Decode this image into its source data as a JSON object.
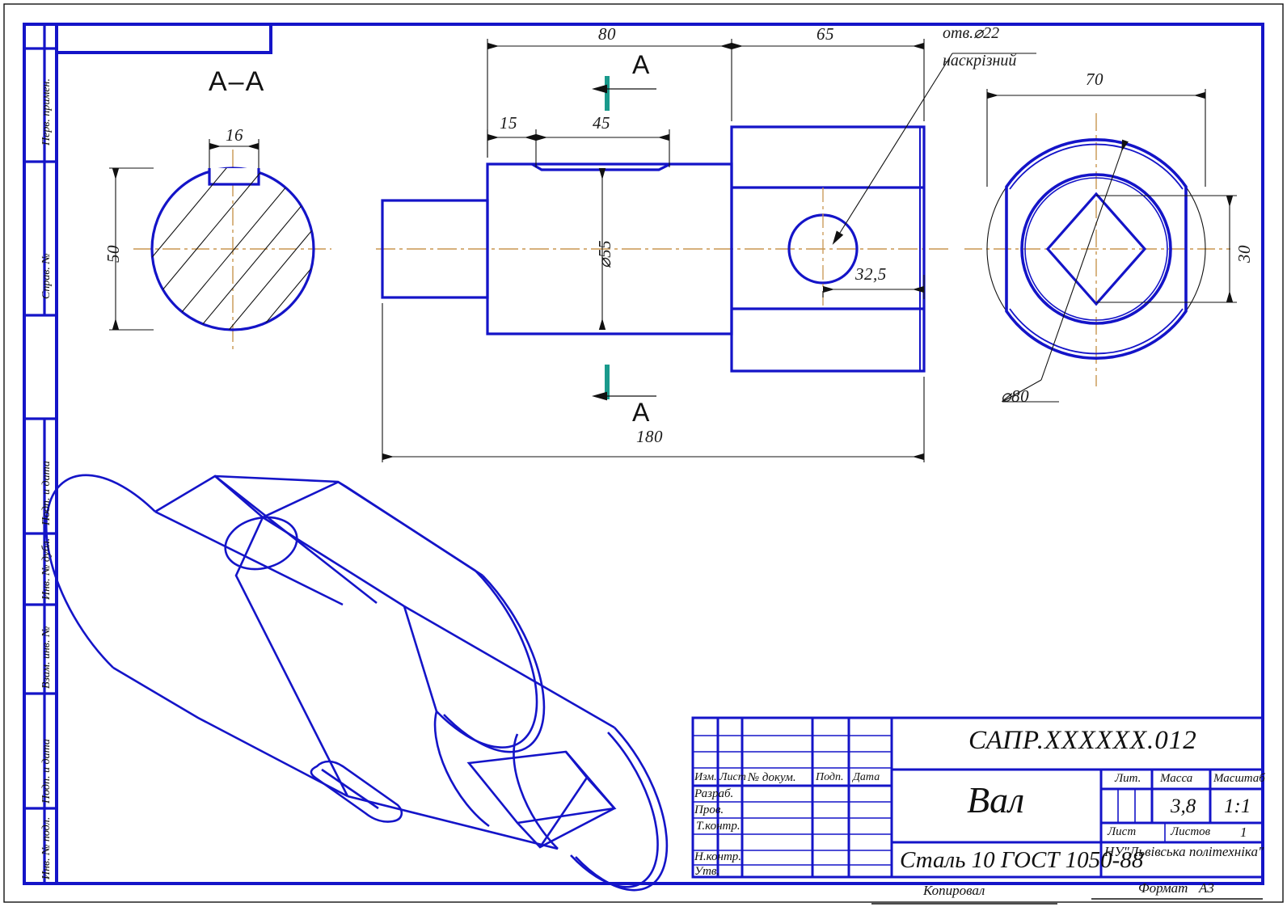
{
  "sheet": {
    "format": "A3",
    "frame_color": "#1414c8",
    "center_line_color": "#c89650",
    "section_mark_color": "#1a9a8c",
    "text_color": "#111111"
  },
  "left_margin": {
    "labels": [
      "Перв. примен.",
      "Справ. №",
      "Подп. и дата",
      "Инв. № дубл.",
      "Взам. инв. №",
      "Подп. и дата",
      "Инв. № подл."
    ]
  },
  "views": {
    "section": {
      "title": "А–А",
      "dims": {
        "keyway_width": "16",
        "diameter": "50"
      }
    },
    "front": {
      "dims": {
        "len_80": "80",
        "len_65": "65",
        "len_15": "15",
        "len_45": "45",
        "dia_55": "⌀55",
        "total_180": "180",
        "hole_offset": "32,5"
      },
      "note": {
        "line1": "отв.⌀22",
        "line2": "наскрізний"
      },
      "section_letters": {
        "top": "А",
        "bottom": "А"
      }
    },
    "right": {
      "dims": {
        "width_70": "70",
        "flat_30": "30",
        "dia_80": "⌀80"
      }
    }
  },
  "title_block": {
    "revision_headers": [
      "Изм.",
      "Лист",
      "№ докум.",
      "Подп.",
      "Дата"
    ],
    "role_rows": [
      "Разраб.",
      "Пров.",
      "Т.контр.",
      "",
      "Н.контр.",
      "Утв."
    ],
    "designation": "САПР.XXXXXX.012",
    "part_name": "Вал",
    "material": "Сталь 10  ГОСТ 1050-88",
    "lit_label": "Лит.",
    "mass_label": "Масса",
    "scale_label": "Масштаб",
    "mass_value": "3,8",
    "scale_value": "1:1",
    "sheet_label": "Лист",
    "sheets_label": "Листов",
    "sheets_value": "1",
    "organization": "НУ\"Львівська політехніка\""
  },
  "footer": {
    "copied_label": "Копировал",
    "format_label": "Формат",
    "format_value": "А3"
  }
}
